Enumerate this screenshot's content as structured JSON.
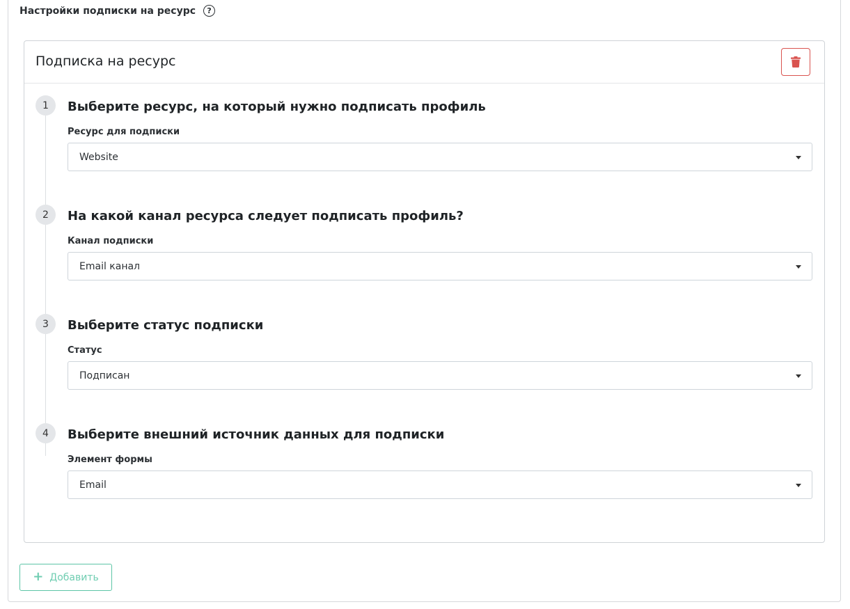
{
  "section": {
    "title": "Настройки подписки на ресурс",
    "help_icon": "question-circle-icon"
  },
  "card": {
    "title": "Подписка на ресурс",
    "delete_icon": "trash-icon",
    "delete_color": "#d9534f"
  },
  "steps": [
    {
      "number": "1",
      "heading": "Выберите ресурс, на который нужно подписать профиль",
      "label": "Ресурс для подписки",
      "value": "Website"
    },
    {
      "number": "2",
      "heading": "На какой канал ресурса следует подписать профиль?",
      "label": "Канал подписки",
      "value": "Email канал"
    },
    {
      "number": "3",
      "heading": "Выберите статус подписки",
      "label": "Статус",
      "value": "Подписан"
    },
    {
      "number": "4",
      "heading": "Выберите внешний источник данных для подписки",
      "label": "Элемент формы",
      "value": "Email"
    }
  ],
  "add_button": {
    "label": "Добавить",
    "icon": "plus-icon",
    "color": "#5cc5a6"
  }
}
